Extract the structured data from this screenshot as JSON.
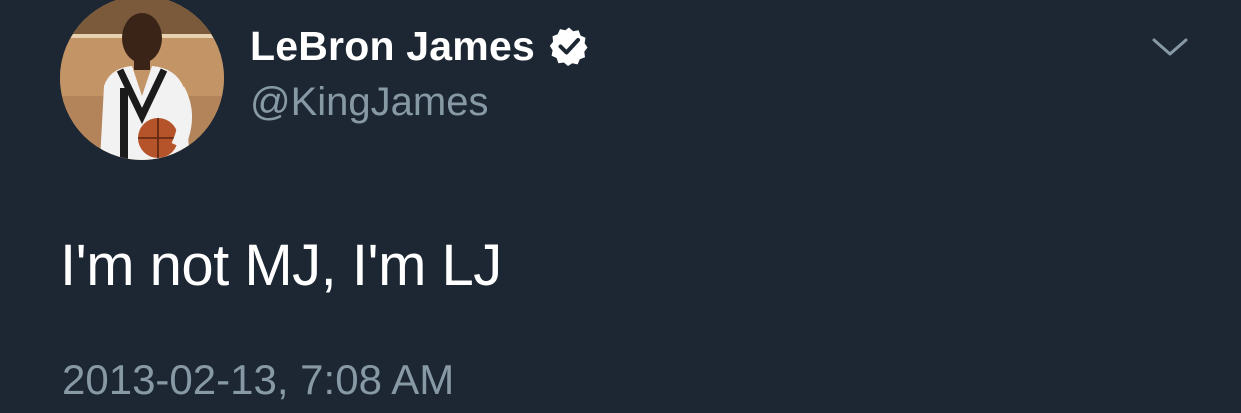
{
  "tweet": {
    "display_name": "LeBron James",
    "handle": "@KingJames",
    "verified": true,
    "text": "I'm not MJ, I'm LJ",
    "timestamp": "2013-02-13, 7:08 AM"
  },
  "icons": {
    "verified": "verified-badge-icon",
    "caret": "chevron-down-icon"
  },
  "colors": {
    "background": "#1c2733",
    "primary_text": "#ffffff",
    "secondary_text": "#8899a6"
  }
}
